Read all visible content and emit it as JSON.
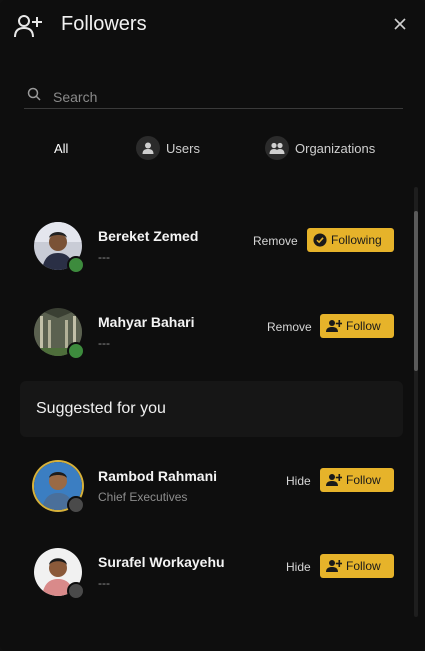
{
  "header": {
    "title": "Followers",
    "icon": "add-user-icon",
    "close_icon": "close-icon"
  },
  "search": {
    "placeholder": "Search",
    "value": ""
  },
  "tabs": [
    {
      "label": "All",
      "active": true
    },
    {
      "label": "Users",
      "icon": "user-icon"
    },
    {
      "label": "Organizations",
      "icon": "group-icon"
    }
  ],
  "followers": [
    {
      "name": "Bereket Zemed",
      "subtitle": "---",
      "status": "online",
      "secondary_action": "Remove",
      "primary_action": "Following",
      "primary_icon": "check-circle-icon"
    },
    {
      "name": "Mahyar Bahari",
      "subtitle": "---",
      "status": "online",
      "secondary_action": "Remove",
      "primary_action": "Follow",
      "primary_icon": "add-user-icon"
    }
  ],
  "suggested": {
    "heading": "Suggested for you",
    "items": [
      {
        "name": "Rambod Rahmani",
        "subtitle": "Chief Executives",
        "status": "offline",
        "secondary_action": "Hide",
        "primary_action": "Follow",
        "primary_icon": "add-user-icon"
      },
      {
        "name": "Surafel Workayehu",
        "subtitle": "---",
        "status": "offline",
        "secondary_action": "Hide",
        "primary_action": "Follow",
        "primary_icon": "add-user-icon"
      }
    ]
  },
  "colors": {
    "accent": "#e6b32a",
    "background": "#0e0e0e",
    "online": "#3d8b3d",
    "offline": "#4a4a4a"
  }
}
